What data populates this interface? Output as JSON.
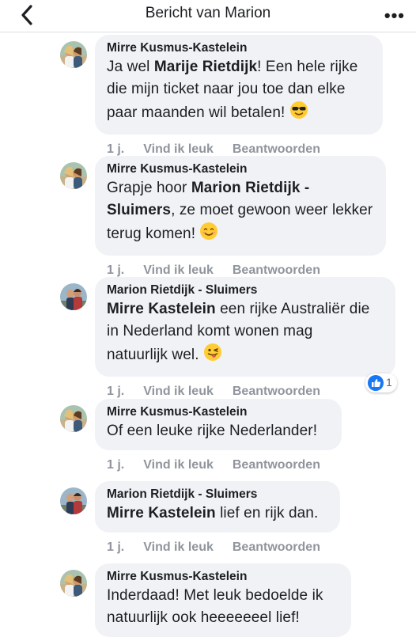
{
  "header": {
    "title": "Bericht van Marion"
  },
  "comments": [
    {
      "author": "Mirre Kusmus-Kastelein",
      "lines": [
        [
          {
            "t": "Ja wel "
          },
          {
            "t": "Marije Rietdijk",
            "b": true
          },
          {
            "t": "! Een hele rijke"
          }
        ],
        [
          {
            "t": "die mijn ticket naar jou toe dan elke"
          }
        ],
        [
          {
            "t": "paar maanden wil betalen! "
          },
          {
            "e": "sunglasses-emoji"
          }
        ]
      ],
      "time": "1 j.",
      "like": "Vind ik leuk",
      "reply": "Beantwoorden"
    },
    {
      "author": "Mirre Kusmus-Kastelein",
      "lines": [
        [
          {
            "t": "Grapje hoor "
          },
          {
            "t": "Marion Rietdijk -",
            "b": true
          }
        ],
        [
          {
            "t": "Sluimers",
            "b": true
          },
          {
            "t": ", ze moet gewoon weer lekker"
          }
        ],
        [
          {
            "t": "terug komen! "
          },
          {
            "e": "smile-emoji"
          }
        ]
      ],
      "time": "1 j.",
      "like": "Vind ik leuk",
      "reply": "Beantwoorden"
    },
    {
      "author": "Marion Rietdijk - Sluimers",
      "lines": [
        [
          {
            "t": "Mirre Kastelein",
            "b": true
          },
          {
            "t": " een rijke Australiër die"
          }
        ],
        [
          {
            "t": "in Nederland komt wonen mag"
          }
        ],
        [
          {
            "t": "natuurlijk wel. "
          },
          {
            "e": "wink-tongue-emoji"
          }
        ]
      ],
      "time": "1 j.",
      "like": "Vind ik leuk",
      "reply": "Beantwoorden",
      "reaction_count": "1"
    },
    {
      "author": "Mirre Kusmus-Kastelein",
      "lines": [
        [
          {
            "t": "Of een leuke rijke Nederlander!"
          }
        ]
      ],
      "time": "1 j.",
      "like": "Vind ik leuk",
      "reply": "Beantwoorden"
    },
    {
      "author": "Marion Rietdijk - Sluimers",
      "lines": [
        [
          {
            "t": "Mirre Kastelein",
            "b": true
          },
          {
            "t": " lief en rijk dan."
          }
        ]
      ],
      "time": "1 j.",
      "like": "Vind ik leuk",
      "reply": "Beantwoorden"
    },
    {
      "author": "Mirre Kusmus-Kastelein",
      "lines": [
        [
          {
            "t": "Inderdaad! Met leuk bedoelde ik"
          }
        ],
        [
          {
            "t": "natuurlijk ook heeeeeeel lief!"
          }
        ]
      ],
      "time": "",
      "like": "",
      "reply": ""
    }
  ],
  "colors": {
    "bubble": "#f1f2f6",
    "meta": "#90949c",
    "like_blue": "#1877f2"
  }
}
